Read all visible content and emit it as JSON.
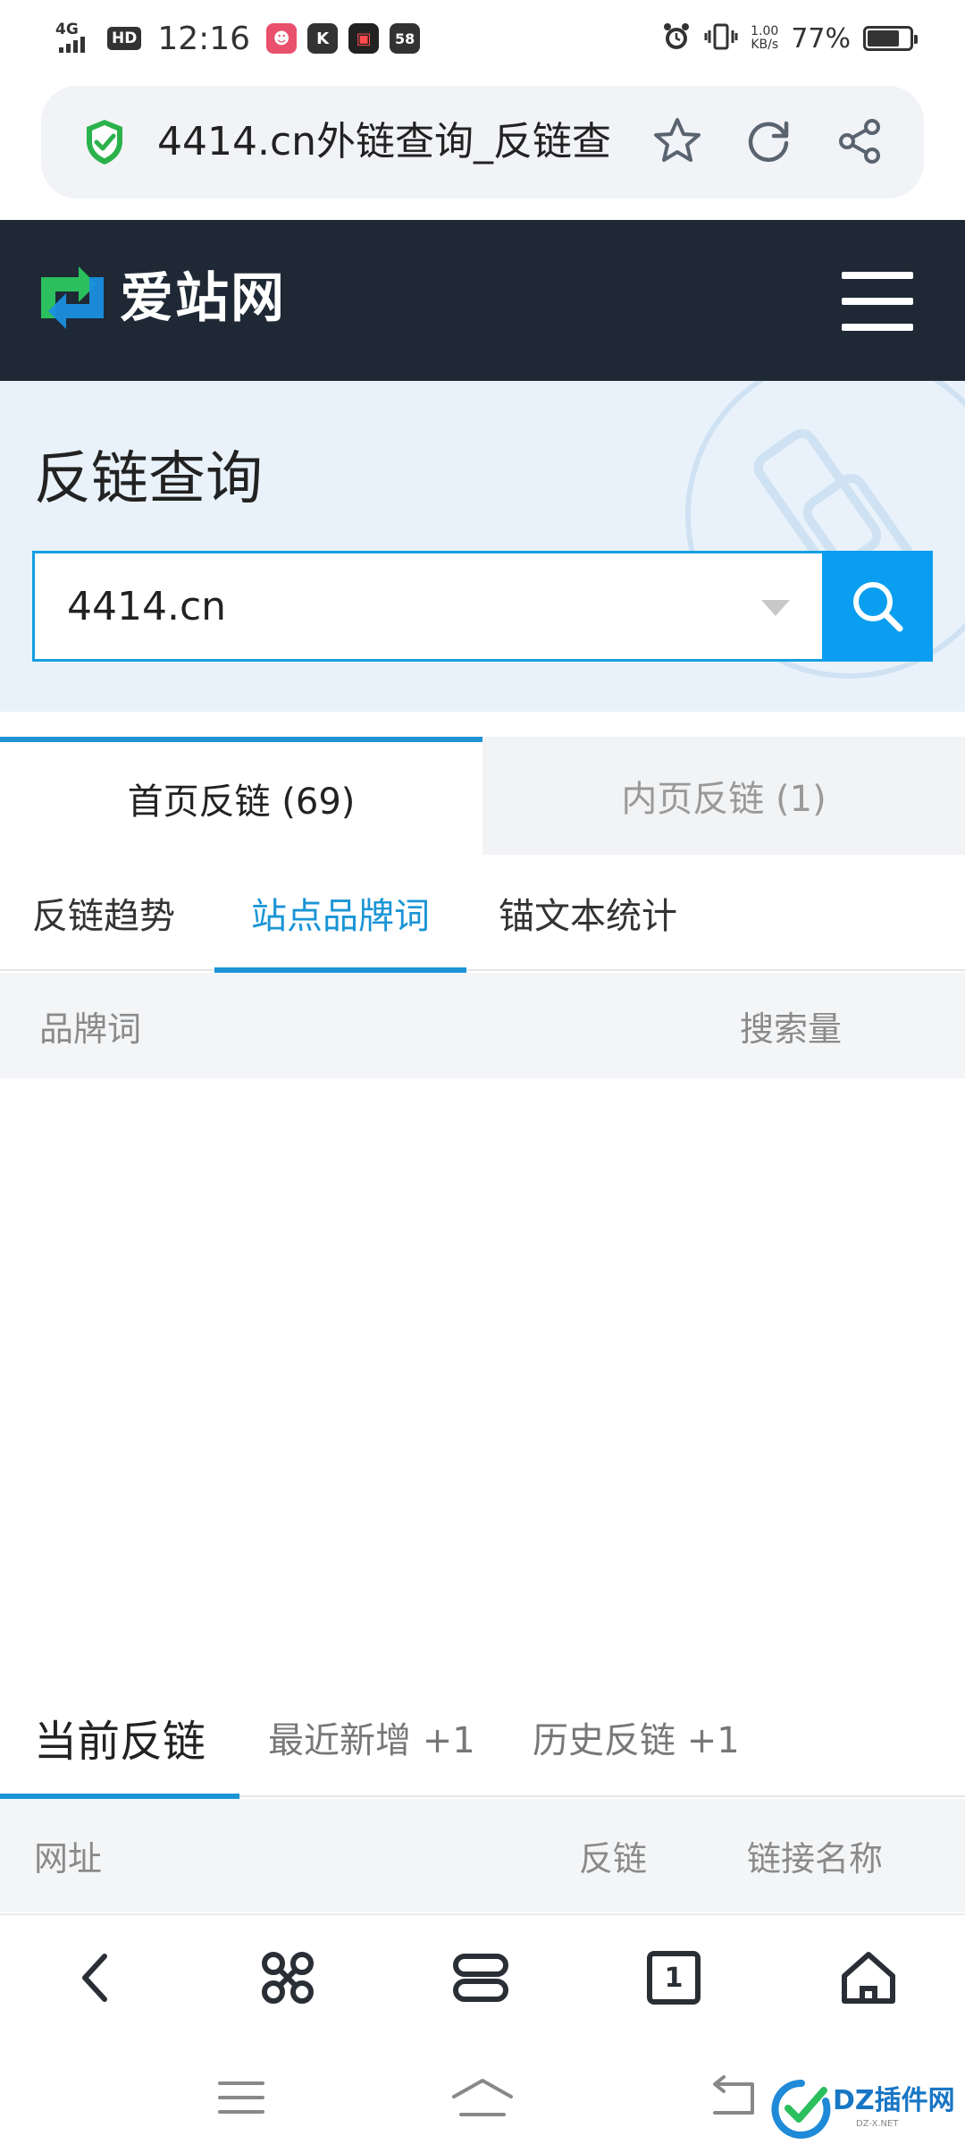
{
  "status_bar": {
    "network": "4G",
    "hd": "HD",
    "time": "12:16",
    "app_badges": [
      {
        "label": "☻",
        "color": "#e9506b"
      },
      {
        "label": "K",
        "color": "#333333"
      },
      {
        "label": "▣",
        "color": "#222222"
      },
      {
        "label": "58",
        "color": "#333333"
      }
    ],
    "speed_value": "1.00",
    "speed_unit": "KB/s",
    "battery_text": "77%",
    "battery_level": 0.77
  },
  "address_bar": {
    "title": "4414.cn外链查询_反链查",
    "icons": [
      "shield-icon",
      "star-icon",
      "refresh-icon",
      "share-icon"
    ]
  },
  "site_header": {
    "name": "爱站网",
    "brand_colors": {
      "green": "#2bbf5d",
      "blue": "#1a8fe0"
    }
  },
  "hero": {
    "title": "反链查询",
    "search_value": "4414.cn"
  },
  "main_tabs": [
    {
      "label": "首页反链 (69)",
      "active": true
    },
    {
      "label": "内页反链 (1)",
      "active": false
    }
  ],
  "sub_tabs": [
    {
      "label": "反链趋势",
      "active": false
    },
    {
      "label": "站点品牌词",
      "active": true
    },
    {
      "label": "锚文本统计",
      "active": false
    }
  ],
  "brand_table": {
    "columns": [
      "品牌词",
      "搜索量"
    ],
    "rows": []
  },
  "link_tabs": [
    {
      "label": "当前反链",
      "active": true
    },
    {
      "label": "最近新增 +1",
      "active": false
    },
    {
      "label": "历史反链 +1",
      "active": false
    }
  ],
  "link_table": {
    "columns": [
      "网址",
      "反链",
      "链接名称"
    ],
    "rows": []
  },
  "browser_toolbar": {
    "tab_count": "1",
    "icons": [
      "back-icon",
      "shortcut-icon",
      "tabs-overview-icon",
      "tab-count-icon",
      "home-icon"
    ]
  },
  "watermark": {
    "text": "DZ插件网",
    "sub": "DZ-X.NET"
  },
  "colors": {
    "accent": "#1a95d6",
    "header_bg": "#1f2935",
    "hero_bg": "#e9f2fa",
    "search_button": "#0a9ef0"
  }
}
